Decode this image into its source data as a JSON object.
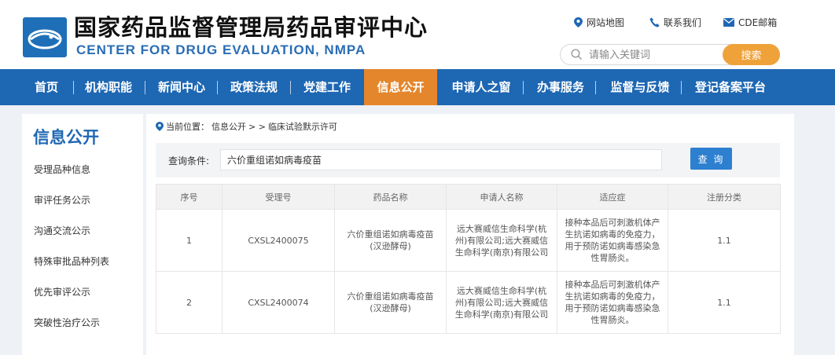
{
  "header": {
    "title": "国家药品监督管理局药品审评中心",
    "subtitle": "CENTER FOR DRUG EVALUATION, NMPA",
    "links": [
      {
        "label": "网站地图",
        "icon": "location-pin-icon"
      },
      {
        "label": "联系我们",
        "icon": "phone-icon"
      },
      {
        "label": "CDE邮箱",
        "icon": "mail-icon"
      }
    ],
    "search": {
      "placeholder": "请输入关键词",
      "button": "搜索"
    }
  },
  "nav": {
    "items": [
      "首页",
      "机构职能",
      "新闻中心",
      "政策法规",
      "党建工作",
      "信息公开",
      "申请人之窗",
      "办事服务",
      "监督与反馈",
      "登记备案平台"
    ],
    "active": "信息公开"
  },
  "sidebar": {
    "title": "信息公开",
    "items": [
      "受理品种信息",
      "审评任务公示",
      "沟通交流公示",
      "特殊审批品种列表",
      "优先审评公示",
      "突破性治疗公示"
    ]
  },
  "breadcrumb": {
    "label": "当前位置：",
    "path": "信息公开",
    "sep": ">  >",
    "current": "临床试验默示许可"
  },
  "query": {
    "label": "查询条件:",
    "value": "六价重组诺如病毒疫苗",
    "button": "查 询"
  },
  "table": {
    "columns": [
      "序号",
      "受理号",
      "药品名称",
      "申请人名称",
      "适应症",
      "注册分类"
    ],
    "rows": [
      {
        "no": "1",
        "accept_no": "CXSL2400075",
        "drug": "六价重组诺如病毒疫苗(汉逊酵母)",
        "applicant": "远大赛威信生命科学(杭州)有限公司;远大赛威信生命科学(南京)有限公司",
        "indication": "接种本品后可刺激机体产生抗诺如病毒的免疫力，用于预防诺如病毒感染急性胃肠炎。",
        "category": "1.1"
      },
      {
        "no": "2",
        "accept_no": "CXSL2400074",
        "drug": "六价重组诺如病毒疫苗(汉逊酵母)",
        "applicant": "远大赛威信生命科学(杭州)有限公司;远大赛威信生命科学(南京)有限公司",
        "indication": "接种本品后可刺激机体产生抗诺如病毒的免疫力，用于预防诺如病毒感染急性胃肠炎。",
        "category": "1.1"
      }
    ]
  },
  "colors": {
    "primary": "#1e67b3",
    "active_nav": "#e4862c",
    "search_button": "#f0a23a",
    "query_button": "#2d7fd0"
  }
}
